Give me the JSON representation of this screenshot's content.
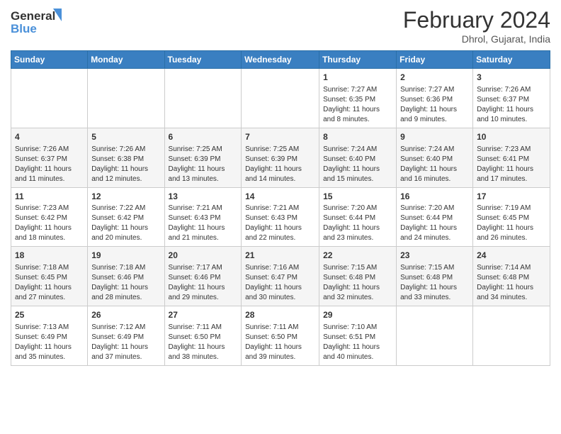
{
  "header": {
    "logo_line1": "General",
    "logo_line2": "Blue",
    "month_title": "February 2024",
    "location": "Dhrol, Gujarat, India"
  },
  "weekdays": [
    "Sunday",
    "Monday",
    "Tuesday",
    "Wednesday",
    "Thursday",
    "Friday",
    "Saturday"
  ],
  "weeks": [
    [
      {
        "day": "",
        "info": ""
      },
      {
        "day": "",
        "info": ""
      },
      {
        "day": "",
        "info": ""
      },
      {
        "day": "",
        "info": ""
      },
      {
        "day": "1",
        "info": "Sunrise: 7:27 AM\nSunset: 6:35 PM\nDaylight: 11 hours and 8 minutes."
      },
      {
        "day": "2",
        "info": "Sunrise: 7:27 AM\nSunset: 6:36 PM\nDaylight: 11 hours and 9 minutes."
      },
      {
        "day": "3",
        "info": "Sunrise: 7:26 AM\nSunset: 6:37 PM\nDaylight: 11 hours and 10 minutes."
      }
    ],
    [
      {
        "day": "4",
        "info": "Sunrise: 7:26 AM\nSunset: 6:37 PM\nDaylight: 11 hours and 11 minutes."
      },
      {
        "day": "5",
        "info": "Sunrise: 7:26 AM\nSunset: 6:38 PM\nDaylight: 11 hours and 12 minutes."
      },
      {
        "day": "6",
        "info": "Sunrise: 7:25 AM\nSunset: 6:39 PM\nDaylight: 11 hours and 13 minutes."
      },
      {
        "day": "7",
        "info": "Sunrise: 7:25 AM\nSunset: 6:39 PM\nDaylight: 11 hours and 14 minutes."
      },
      {
        "day": "8",
        "info": "Sunrise: 7:24 AM\nSunset: 6:40 PM\nDaylight: 11 hours and 15 minutes."
      },
      {
        "day": "9",
        "info": "Sunrise: 7:24 AM\nSunset: 6:40 PM\nDaylight: 11 hours and 16 minutes."
      },
      {
        "day": "10",
        "info": "Sunrise: 7:23 AM\nSunset: 6:41 PM\nDaylight: 11 hours and 17 minutes."
      }
    ],
    [
      {
        "day": "11",
        "info": "Sunrise: 7:23 AM\nSunset: 6:42 PM\nDaylight: 11 hours and 18 minutes."
      },
      {
        "day": "12",
        "info": "Sunrise: 7:22 AM\nSunset: 6:42 PM\nDaylight: 11 hours and 20 minutes."
      },
      {
        "day": "13",
        "info": "Sunrise: 7:21 AM\nSunset: 6:43 PM\nDaylight: 11 hours and 21 minutes."
      },
      {
        "day": "14",
        "info": "Sunrise: 7:21 AM\nSunset: 6:43 PM\nDaylight: 11 hours and 22 minutes."
      },
      {
        "day": "15",
        "info": "Sunrise: 7:20 AM\nSunset: 6:44 PM\nDaylight: 11 hours and 23 minutes."
      },
      {
        "day": "16",
        "info": "Sunrise: 7:20 AM\nSunset: 6:44 PM\nDaylight: 11 hours and 24 minutes."
      },
      {
        "day": "17",
        "info": "Sunrise: 7:19 AM\nSunset: 6:45 PM\nDaylight: 11 hours and 26 minutes."
      }
    ],
    [
      {
        "day": "18",
        "info": "Sunrise: 7:18 AM\nSunset: 6:45 PM\nDaylight: 11 hours and 27 minutes."
      },
      {
        "day": "19",
        "info": "Sunrise: 7:18 AM\nSunset: 6:46 PM\nDaylight: 11 hours and 28 minutes."
      },
      {
        "day": "20",
        "info": "Sunrise: 7:17 AM\nSunset: 6:46 PM\nDaylight: 11 hours and 29 minutes."
      },
      {
        "day": "21",
        "info": "Sunrise: 7:16 AM\nSunset: 6:47 PM\nDaylight: 11 hours and 30 minutes."
      },
      {
        "day": "22",
        "info": "Sunrise: 7:15 AM\nSunset: 6:48 PM\nDaylight: 11 hours and 32 minutes."
      },
      {
        "day": "23",
        "info": "Sunrise: 7:15 AM\nSunset: 6:48 PM\nDaylight: 11 hours and 33 minutes."
      },
      {
        "day": "24",
        "info": "Sunrise: 7:14 AM\nSunset: 6:48 PM\nDaylight: 11 hours and 34 minutes."
      }
    ],
    [
      {
        "day": "25",
        "info": "Sunrise: 7:13 AM\nSunset: 6:49 PM\nDaylight: 11 hours and 35 minutes."
      },
      {
        "day": "26",
        "info": "Sunrise: 7:12 AM\nSunset: 6:49 PM\nDaylight: 11 hours and 37 minutes."
      },
      {
        "day": "27",
        "info": "Sunrise: 7:11 AM\nSunset: 6:50 PM\nDaylight: 11 hours and 38 minutes."
      },
      {
        "day": "28",
        "info": "Sunrise: 7:11 AM\nSunset: 6:50 PM\nDaylight: 11 hours and 39 minutes."
      },
      {
        "day": "29",
        "info": "Sunrise: 7:10 AM\nSunset: 6:51 PM\nDaylight: 11 hours and 40 minutes."
      },
      {
        "day": "",
        "info": ""
      },
      {
        "day": "",
        "info": ""
      }
    ]
  ]
}
